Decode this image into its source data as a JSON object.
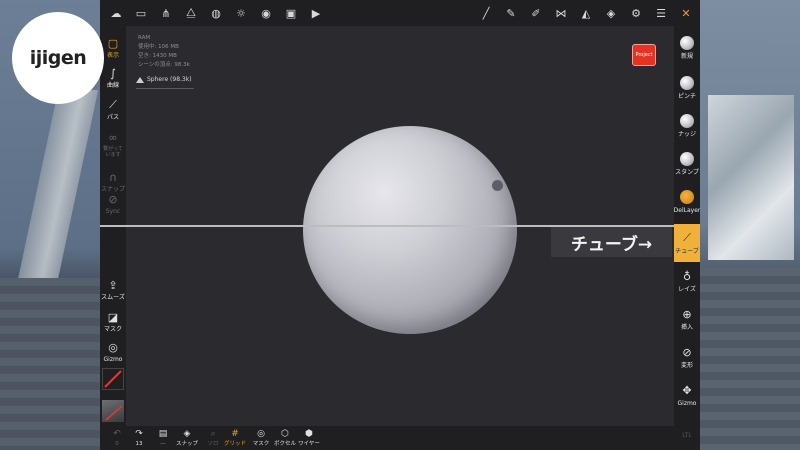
{
  "logo": {
    "text": "ijigen"
  },
  "topbar": {
    "left_icons": [
      "cloud-icon",
      "folder-icon",
      "share-icon",
      "layers-icon",
      "globe-icon",
      "sun-icon",
      "material-icon",
      "image-icon",
      "video-icon"
    ],
    "right_icons": [
      "pen-icon",
      "pencil-icon",
      "eyedropper-icon",
      "mirror-icon",
      "triangle-icon",
      "stack-icon",
      "gear-icon",
      "sliders-icon",
      "tools-icon"
    ]
  },
  "info": {
    "lines": [
      "RAM",
      "使用中: 106 MB",
      "空き: 1430 MB",
      "シーンの頂点: 98.3k"
    ],
    "mesh": "Sphere (98.3k)"
  },
  "project_button": "Project",
  "callout": "チューブ→",
  "left_tools": [
    {
      "name": "display",
      "label": "表示",
      "icon": "camera-icon",
      "state": "accent"
    },
    {
      "name": "curve",
      "label": "曲線",
      "icon": "curve-icon",
      "state": "normal"
    },
    {
      "name": "path",
      "label": "パス",
      "icon": "path-icon",
      "state": "normal"
    },
    {
      "name": "connected",
      "label": "繋がっています",
      "icon": "link-icon",
      "state": "dim"
    },
    {
      "name": "snap",
      "label": "スナップ",
      "icon": "magnet-icon",
      "state": "dim"
    },
    {
      "name": "sync",
      "label": "Sync",
      "icon": "chain-icon",
      "state": "dim"
    },
    {
      "name": "smooth",
      "label": "スムーズ",
      "icon": "upload-icon",
      "state": "normal"
    },
    {
      "name": "mask",
      "label": "マスク",
      "icon": "mask-icon",
      "state": "normal"
    },
    {
      "name": "gizmo",
      "label": "Gizmo",
      "icon": "gizmo-icon",
      "state": "normal"
    }
  ],
  "right_tools": [
    {
      "name": "new",
      "label": "新規"
    },
    {
      "name": "pinch",
      "label": "ピンチ"
    },
    {
      "name": "nudge",
      "label": "ナッジ"
    },
    {
      "name": "stamp",
      "label": "スタンプ"
    },
    {
      "name": "dellayer",
      "label": "DelLayer"
    },
    {
      "name": "tube",
      "label": "チューブ"
    },
    {
      "name": "lathe",
      "label": "レイズ"
    },
    {
      "name": "insert",
      "label": "挿入"
    },
    {
      "name": "transform",
      "label": "変形"
    },
    {
      "name": "gizmo",
      "label": "Gizmo"
    }
  ],
  "right_footer": "LTL",
  "bottom_tools": [
    {
      "name": "undo",
      "label": "0",
      "icon": "↶",
      "state": "dim"
    },
    {
      "name": "redo",
      "label": "13",
      "icon": "↷",
      "state": "normal"
    },
    {
      "name": "history",
      "label": "⋯",
      "icon": "▤",
      "state": "normal"
    },
    {
      "name": "snap",
      "label": "スナップ",
      "icon": "◈",
      "state": "normal"
    },
    {
      "name": "zoom",
      "label": "ソロ",
      "icon": "⌕",
      "state": "dim"
    },
    {
      "name": "grid",
      "label": "グリッド",
      "icon": "#",
      "state": "accent"
    },
    {
      "name": "mask",
      "label": "マスク",
      "icon": "◎",
      "state": "normal"
    },
    {
      "name": "voxel",
      "label": "ボクセル",
      "icon": "⬡",
      "state": "normal"
    },
    {
      "name": "wire",
      "label": "ワイヤー",
      "icon": "⬢",
      "state": "normal"
    }
  ]
}
